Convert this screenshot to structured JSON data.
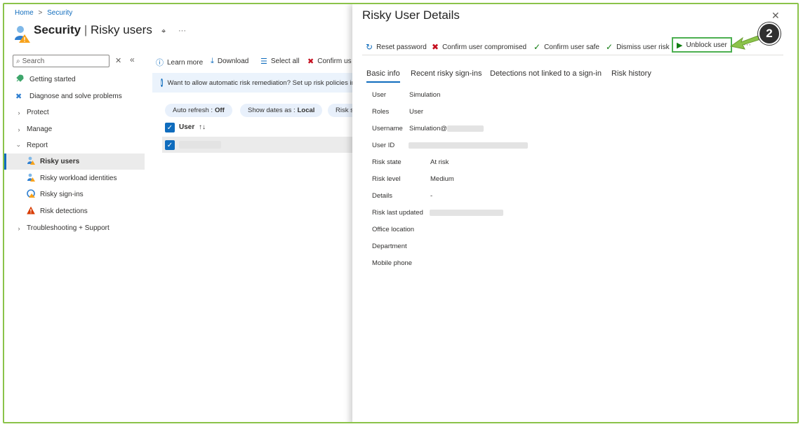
{
  "breadcrumb": {
    "home": "Home",
    "separator": ">",
    "section": "Security"
  },
  "page": {
    "title_main": "Security",
    "title_divider": "|",
    "title_sub": "Risky users",
    "more": "···"
  },
  "sidebar": {
    "search_placeholder": "Search",
    "items": [
      {
        "label": "Getting started",
        "icon": "rocket-icon",
        "indent": 0
      },
      {
        "label": "Diagnose and solve problems",
        "icon": "wrench-icon",
        "indent": 0
      },
      {
        "label": "Protect",
        "icon": "chevron-right-icon",
        "indent": 0
      },
      {
        "label": "Manage",
        "icon": "chevron-right-icon",
        "indent": 0
      },
      {
        "label": "Report",
        "icon": "chevron-down-icon",
        "indent": 0
      },
      {
        "label": "Risky users",
        "icon": "risky-user-icon",
        "indent": 1,
        "active": true
      },
      {
        "label": "Risky workload identities",
        "icon": "workload-identity-icon",
        "indent": 1
      },
      {
        "label": "Risky sign-ins",
        "icon": "risky-signin-icon",
        "indent": 1
      },
      {
        "label": "Risk detections",
        "icon": "warning-icon",
        "indent": 1
      },
      {
        "label": "Troubleshooting + Support",
        "icon": "chevron-right-icon",
        "indent": 0
      }
    ]
  },
  "toolbar": {
    "learn_more": "Learn more",
    "download": "Download",
    "select_all": "Select all",
    "confirm": "Confirm us"
  },
  "banner": {
    "text": "Want to allow automatic risk remediation? Set up risk policies in C"
  },
  "filters": {
    "auto_refresh_label": "Auto refresh :",
    "auto_refresh_value": "Off",
    "show_dates_label": "Show dates as :",
    "show_dates_value": "Local",
    "risk": "Risk s"
  },
  "table": {
    "header_user": "User",
    "sort_glyph": "↑↓"
  },
  "details": {
    "title": "Risky User Details",
    "actions": {
      "reset_password": "Reset password",
      "confirm_compromised": "Confirm user compromised",
      "confirm_safe": "Confirm user safe",
      "dismiss_risk": "Dismiss user risk",
      "unblock_user": "Unblock user",
      "more": "···"
    },
    "tabs": [
      "Basic info",
      "Recent risky sign-ins",
      "Detections not linked to a sign-in",
      "Risk history"
    ],
    "fields": {
      "user_label": "User",
      "user_value": "Simulation",
      "roles_label": "Roles",
      "roles_value": "User",
      "username_label": "Username",
      "username_value": "Simulation@",
      "userid_label": "User ID",
      "risk_state_label": "Risk state",
      "risk_state_value": "At risk",
      "risk_level_label": "Risk level",
      "risk_level_value": "Medium",
      "details_label": "Details",
      "details_value": "-",
      "risk_updated_label": "Risk last updated",
      "office_label": "Office location",
      "department_label": "Department",
      "mobile_label": "Mobile phone"
    }
  },
  "callout": {
    "step": "2"
  },
  "colors": {
    "accent": "#0f6cbd",
    "highlight": "#4caf50",
    "callout_bg": "#2f2f2f",
    "arrow": "#8bc34a",
    "danger": "#c50f1f",
    "success": "#107c10"
  }
}
